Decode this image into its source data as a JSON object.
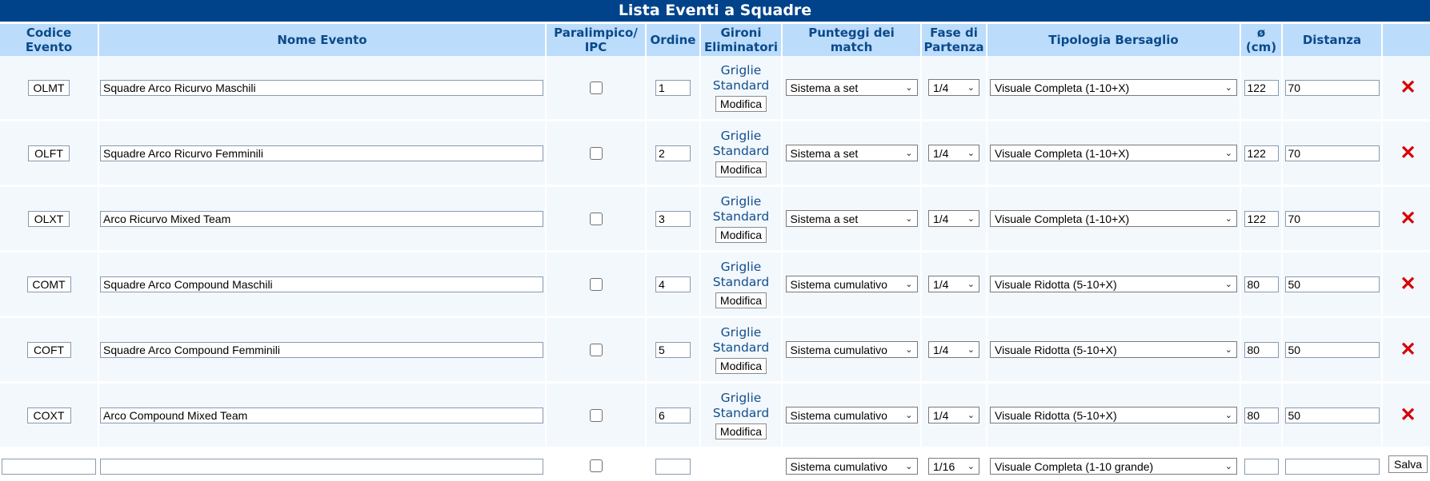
{
  "page_title": "Lista Eventi a Squadre",
  "columns": {
    "code": [
      "Codice",
      "Evento"
    ],
    "name": "Nome Evento",
    "para": [
      "Paralimpico/",
      "IPC"
    ],
    "order": "Ordine",
    "brackets": [
      "Gironi",
      "Eliminatori"
    ],
    "match": [
      "Punteggi dei",
      "match"
    ],
    "phase": [
      "Fase di",
      "Partenza"
    ],
    "target": "Tipologia Bersaglio",
    "diam": [
      "ø",
      "(cm)"
    ],
    "distance": "Distanza"
  },
  "bracket_link": [
    "Griglie",
    "Standard"
  ],
  "modify_label": "Modifica",
  "delete_icon": "✕",
  "save_label": "Salva",
  "rows": [
    {
      "code": "OLMT",
      "name": "Squadre Arco Ricurvo Maschili",
      "order": "1",
      "match": "Sistema a set",
      "phase": "1/4",
      "target": "Visuale Completa (1-10+X)",
      "diam": "122",
      "distance": "70"
    },
    {
      "code": "OLFT",
      "name": "Squadre Arco Ricurvo Femminili",
      "order": "2",
      "match": "Sistema a set",
      "phase": "1/4",
      "target": "Visuale Completa (1-10+X)",
      "diam": "122",
      "distance": "70"
    },
    {
      "code": "OLXT",
      "name": "Arco Ricurvo Mixed Team",
      "order": "3",
      "match": "Sistema a set",
      "phase": "1/4",
      "target": "Visuale Completa (1-10+X)",
      "diam": "122",
      "distance": "70"
    },
    {
      "code": "COMT",
      "name": "Squadre Arco Compound Maschili",
      "order": "4",
      "match": "Sistema cumulativo",
      "phase": "1/4",
      "target": "Visuale Ridotta (5-10+X)",
      "diam": "80",
      "distance": "50"
    },
    {
      "code": "COFT",
      "name": "Squadre Arco Compound Femminili",
      "order": "5",
      "match": "Sistema cumulativo",
      "phase": "1/4",
      "target": "Visuale Ridotta (5-10+X)",
      "diam": "80",
      "distance": "50"
    },
    {
      "code": "COXT",
      "name": "Arco Compound Mixed Team",
      "order": "6",
      "match": "Sistema cumulativo",
      "phase": "1/4",
      "target": "Visuale Ridotta (5-10+X)",
      "diam": "80",
      "distance": "50"
    }
  ],
  "new_row": {
    "code": "",
    "name": "",
    "order": "",
    "match": "Sistema cumulativo",
    "phase": "1/16",
    "target": "Visuale Completa (1-10 grande)",
    "diam": "",
    "distance": ""
  },
  "colors": {
    "header_bar": "#00438a",
    "column_header": "#bcdcfc",
    "row_bg": "#f3f8fd",
    "delete": "#d80000"
  }
}
